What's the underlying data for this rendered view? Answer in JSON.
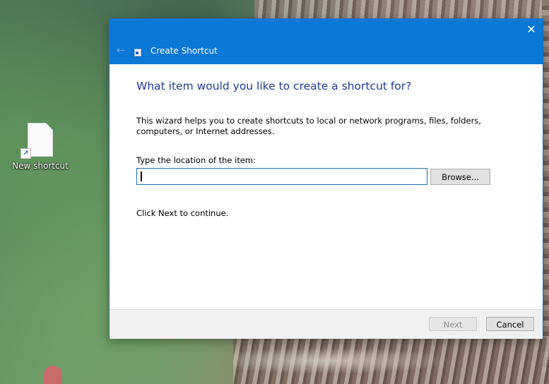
{
  "desktop": {
    "icons": [
      {
        "label": "New shortcut",
        "icon": "blank-file-shortcut-icon"
      }
    ]
  },
  "window": {
    "title": "Create Shortcut",
    "close_glyph": "✕",
    "back_glyph": "←",
    "accent_color": "#0a78d7",
    "heading": "What item would you like to create a shortcut for?",
    "description": "This wizard helps you to create shortcuts to local or network programs, files, folders, computers, or Internet addresses.",
    "location_label": "Type the location of the item:",
    "location_value": "",
    "browse_label": "Browse...",
    "continue_text": "Click Next to continue.",
    "next_label": "Next",
    "next_enabled": false,
    "cancel_label": "Cancel"
  }
}
